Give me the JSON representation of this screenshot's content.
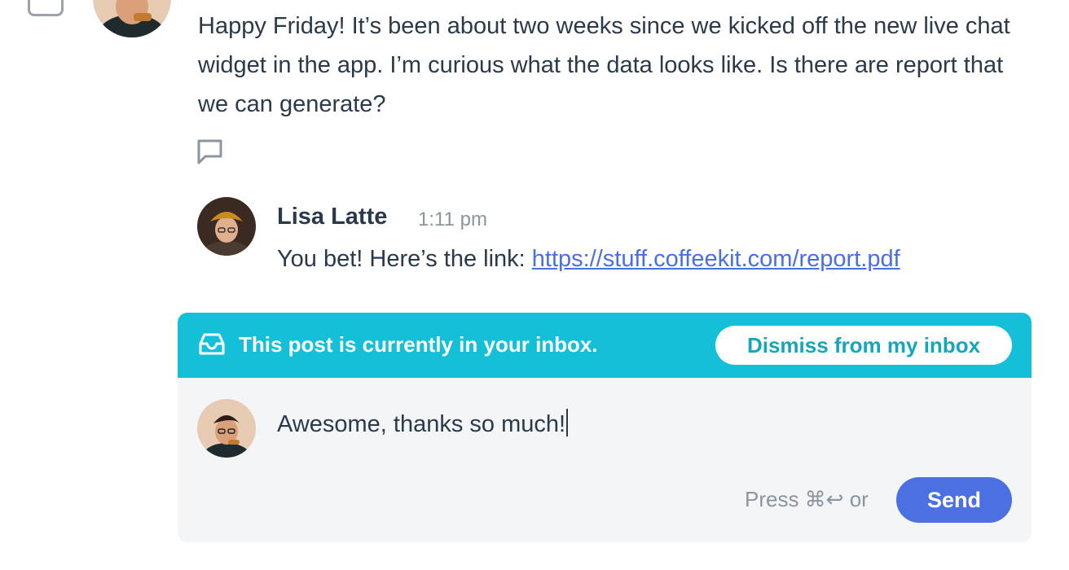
{
  "post": {
    "body": "Happy Friday! It’s been about two weeks since we kicked off the new live chat widget in the app. I’m curious what the data looks like. Is there are report that we can generate?"
  },
  "reply": {
    "author": "Lisa Latte",
    "time": "1:11 pm",
    "text_prefix": "You bet! Here’s the link: ",
    "link_text": "https://stuff.coffeekit.com/report.pdf"
  },
  "inbox_banner": {
    "message": "This post is currently in your inbox.",
    "dismiss_label": "Dismiss from my inbox"
  },
  "composer": {
    "draft_text": "Awesome, thanks so much!",
    "hint": "Press ⌘↩ or",
    "send_label": "Send"
  },
  "colors": {
    "banner": "#14c0d8",
    "send_button": "#4a70e2",
    "link": "#4a6fe0",
    "text": "#2b3a4a",
    "muted": "#8a95a0"
  },
  "icons": {
    "comment": "comment-icon",
    "inbox": "inbox-icon"
  }
}
